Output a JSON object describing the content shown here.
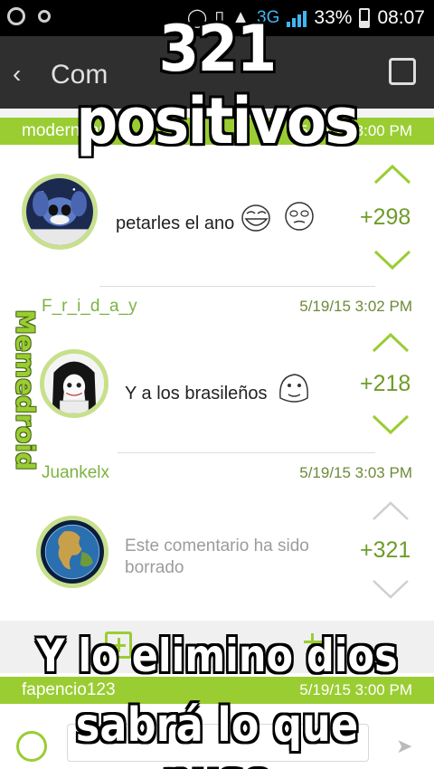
{
  "status_bar": {
    "network": "3G",
    "battery": "33%",
    "time": "08:07"
  },
  "toolbar": {
    "title": "Com"
  },
  "captions": {
    "top": "321 positivos",
    "bottom_line1": "Y lo elimino dios",
    "bottom_line2": "sabrá lo que puso"
  },
  "watermark": "Memedroid",
  "comments": [
    {
      "user": "modernpami",
      "timestamp": "5/19/15 3:00 PM",
      "text": "petarles el ano",
      "score": "+298"
    },
    {
      "user": "F_r_i_d_a_y",
      "timestamp": "5/19/15 3:02 PM",
      "text": "Y a los brasileños",
      "score": "+218"
    },
    {
      "user": "Juankelx",
      "timestamp": "5/19/15 3:03 PM",
      "text": "Este comentario ha sido borrado",
      "score": "+321"
    },
    {
      "user": "fapencio123",
      "timestamp": "5/19/15 3:00 PM"
    }
  ],
  "colors": {
    "accent_green": "#9acd32",
    "score_green": "#6f9c2a",
    "toolbar": "#2f2f2f"
  }
}
